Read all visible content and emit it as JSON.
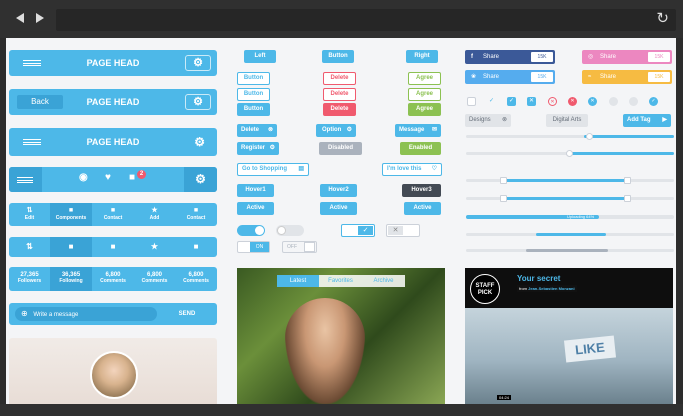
{
  "header_bars": [
    {
      "title": "PAGE HEAD"
    },
    {
      "title": "PAGE HEAD",
      "back_label": "Back"
    },
    {
      "title": "PAGE HEAD"
    }
  ],
  "notification_count": "2",
  "tabbar1": [
    "Edit",
    "Components",
    "Contact",
    "Add",
    "Contact"
  ],
  "stats": [
    {
      "value": "27,365",
      "label": "Followers"
    },
    {
      "value": "36,365",
      "label": "Following"
    },
    {
      "value": "6,800",
      "label": "Comments"
    },
    {
      "value": "6,800",
      "label": "Comments"
    },
    {
      "value": "6,800",
      "label": "Comments"
    }
  ],
  "message": {
    "placeholder": "Write a message",
    "send_label": "SEND"
  },
  "buttons": {
    "left": "Left",
    "button": "Button",
    "right": "Right",
    "delete": "Delete",
    "agree": "Agree",
    "option": "Option",
    "message": "Message",
    "register": "Register",
    "disabled": "Disabled",
    "enabled": "Enabled",
    "go_shopping": "Go to Shopping",
    "love": "I'm love this",
    "hover1": "Hover1",
    "hover2": "Hover2",
    "hover3": "Hover3",
    "active": "Active",
    "on": "ON",
    "off": "OFF"
  },
  "gallery_tabs": [
    "Latest",
    "Favorites",
    "Archive"
  ],
  "share": [
    {
      "label": "Share",
      "count": "15K",
      "color": "#3b5998"
    },
    {
      "label": "Share",
      "count": "15K",
      "color": "#ec87c0"
    },
    {
      "label": "Share",
      "count": "15K",
      "color": "#55acee"
    },
    {
      "label": "Share",
      "count": "15K",
      "color": "#f6bb42"
    }
  ],
  "tags": [
    "Designs",
    "Digital Arts",
    "Add Tag"
  ],
  "progress_label": "Uploading 64%",
  "progress": 0.64,
  "video": {
    "badge_line1": "STAFF",
    "badge_line2": "PICK",
    "title": "Your secret",
    "from_label": "from",
    "author": "Jean-Sebastien Monzani",
    "time": "04:24",
    "sign_text": "LIKE"
  },
  "colors": {
    "accent": "#4db8e8",
    "danger": "#f05a6e",
    "success": "#8cc152",
    "dark": "#434a54"
  }
}
